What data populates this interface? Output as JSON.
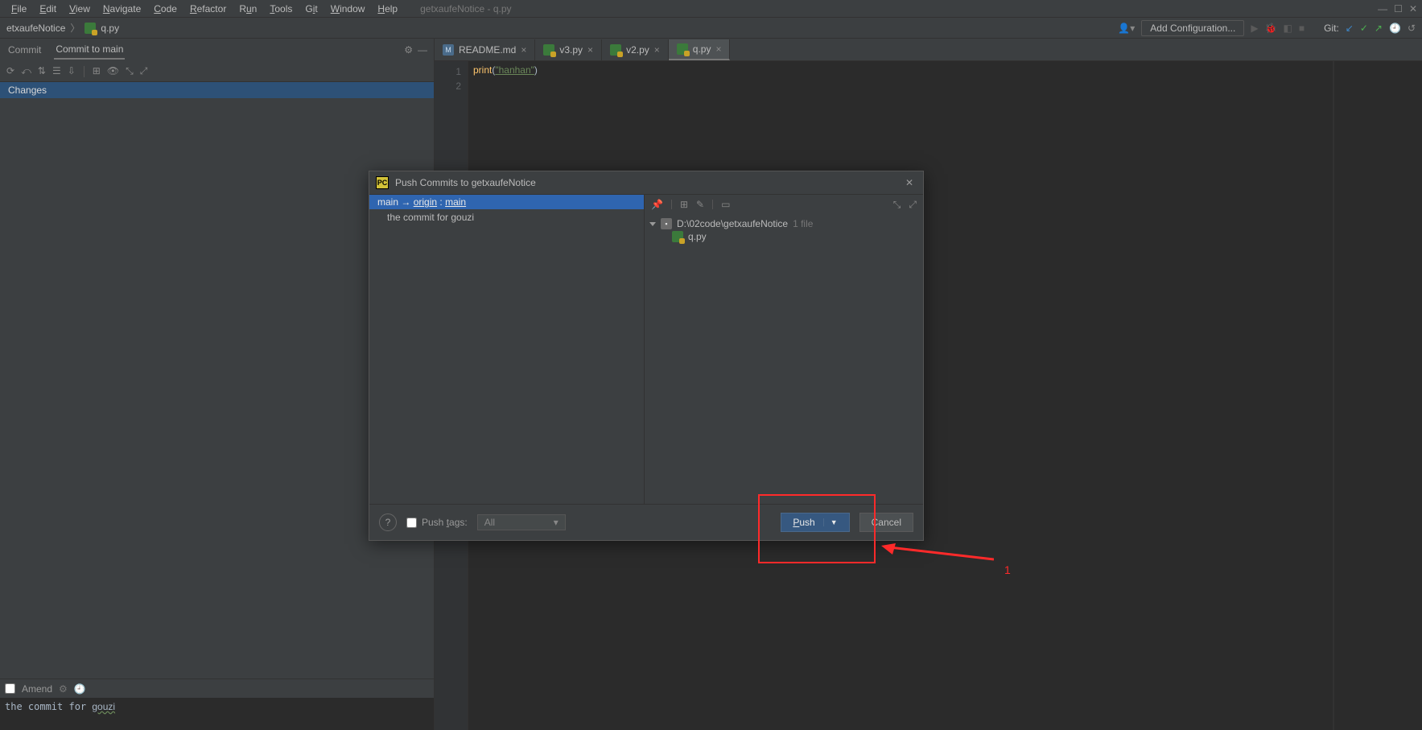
{
  "menubar": {
    "items": [
      "File",
      "Edit",
      "View",
      "Navigate",
      "Code",
      "Refactor",
      "Run",
      "Tools",
      "Git",
      "Window",
      "Help"
    ],
    "title": "getxaufeNotice - q.py"
  },
  "breadcrumb": {
    "project": "etxaufeNotice",
    "file": "q.py"
  },
  "navbar": {
    "add_config": "Add Configuration...",
    "git_label": "Git:"
  },
  "commit_panel": {
    "tab_commit": "Commit",
    "tab_branch": "Commit to main",
    "changes_label": "Changes",
    "amend_label": "Amend",
    "message": "the commit for gouzi"
  },
  "editor": {
    "tabs": [
      {
        "label": "README.md",
        "icon": "md"
      },
      {
        "label": "v3.py",
        "icon": "py"
      },
      {
        "label": "v2.py",
        "icon": "py"
      },
      {
        "label": "q.py",
        "icon": "py",
        "active": true
      }
    ],
    "code_line": {
      "fn": "print",
      "str": "\"hanhan\""
    },
    "line_numbers": [
      "1",
      "2"
    ]
  },
  "dialog": {
    "title": "Push Commits to getxaufeNotice",
    "branch": {
      "local": "main",
      "arrow": "→",
      "remote": "origin",
      "sep": ":",
      "remote_branch": "main"
    },
    "commit": "the commit for gouzi",
    "tree": {
      "root": "D:\\02code\\getxaufeNotice",
      "root_count": "1 file",
      "file": "q.py"
    },
    "footer": {
      "push_tags": "Push tags:",
      "tags_value": "All",
      "push": "Push",
      "cancel": "Cancel"
    }
  },
  "annotation": {
    "label": "1"
  }
}
